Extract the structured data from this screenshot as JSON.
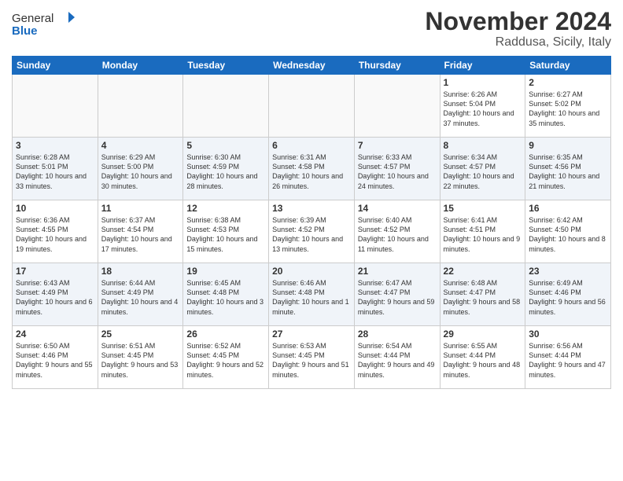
{
  "header": {
    "logo": {
      "general": "General",
      "blue": "Blue"
    },
    "month_title": "November 2024",
    "location": "Raddusa, Sicily, Italy"
  },
  "weekdays": [
    "Sunday",
    "Monday",
    "Tuesday",
    "Wednesday",
    "Thursday",
    "Friday",
    "Saturday"
  ],
  "weeks": [
    {
      "row_style": "odd-row",
      "days": [
        {
          "num": "",
          "info": "",
          "empty": true
        },
        {
          "num": "",
          "info": "",
          "empty": true
        },
        {
          "num": "",
          "info": "",
          "empty": true
        },
        {
          "num": "",
          "info": "",
          "empty": true
        },
        {
          "num": "",
          "info": "",
          "empty": true
        },
        {
          "num": "1",
          "info": "Sunrise: 6:26 AM\nSunset: 5:04 PM\nDaylight: 10 hours and 37 minutes."
        },
        {
          "num": "2",
          "info": "Sunrise: 6:27 AM\nSunset: 5:02 PM\nDaylight: 10 hours and 35 minutes."
        }
      ]
    },
    {
      "row_style": "even-row",
      "days": [
        {
          "num": "3",
          "info": "Sunrise: 6:28 AM\nSunset: 5:01 PM\nDaylight: 10 hours and 33 minutes."
        },
        {
          "num": "4",
          "info": "Sunrise: 6:29 AM\nSunset: 5:00 PM\nDaylight: 10 hours and 30 minutes."
        },
        {
          "num": "5",
          "info": "Sunrise: 6:30 AM\nSunset: 4:59 PM\nDaylight: 10 hours and 28 minutes."
        },
        {
          "num": "6",
          "info": "Sunrise: 6:31 AM\nSunset: 4:58 PM\nDaylight: 10 hours and 26 minutes."
        },
        {
          "num": "7",
          "info": "Sunrise: 6:33 AM\nSunset: 4:57 PM\nDaylight: 10 hours and 24 minutes."
        },
        {
          "num": "8",
          "info": "Sunrise: 6:34 AM\nSunset: 4:57 PM\nDaylight: 10 hours and 22 minutes."
        },
        {
          "num": "9",
          "info": "Sunrise: 6:35 AM\nSunset: 4:56 PM\nDaylight: 10 hours and 21 minutes."
        }
      ]
    },
    {
      "row_style": "odd-row",
      "days": [
        {
          "num": "10",
          "info": "Sunrise: 6:36 AM\nSunset: 4:55 PM\nDaylight: 10 hours and 19 minutes."
        },
        {
          "num": "11",
          "info": "Sunrise: 6:37 AM\nSunset: 4:54 PM\nDaylight: 10 hours and 17 minutes."
        },
        {
          "num": "12",
          "info": "Sunrise: 6:38 AM\nSunset: 4:53 PM\nDaylight: 10 hours and 15 minutes."
        },
        {
          "num": "13",
          "info": "Sunrise: 6:39 AM\nSunset: 4:52 PM\nDaylight: 10 hours and 13 minutes."
        },
        {
          "num": "14",
          "info": "Sunrise: 6:40 AM\nSunset: 4:52 PM\nDaylight: 10 hours and 11 minutes."
        },
        {
          "num": "15",
          "info": "Sunrise: 6:41 AM\nSunset: 4:51 PM\nDaylight: 10 hours and 9 minutes."
        },
        {
          "num": "16",
          "info": "Sunrise: 6:42 AM\nSunset: 4:50 PM\nDaylight: 10 hours and 8 minutes."
        }
      ]
    },
    {
      "row_style": "even-row",
      "days": [
        {
          "num": "17",
          "info": "Sunrise: 6:43 AM\nSunset: 4:49 PM\nDaylight: 10 hours and 6 minutes."
        },
        {
          "num": "18",
          "info": "Sunrise: 6:44 AM\nSunset: 4:49 PM\nDaylight: 10 hours and 4 minutes."
        },
        {
          "num": "19",
          "info": "Sunrise: 6:45 AM\nSunset: 4:48 PM\nDaylight: 10 hours and 3 minutes."
        },
        {
          "num": "20",
          "info": "Sunrise: 6:46 AM\nSunset: 4:48 PM\nDaylight: 10 hours and 1 minute."
        },
        {
          "num": "21",
          "info": "Sunrise: 6:47 AM\nSunset: 4:47 PM\nDaylight: 9 hours and 59 minutes."
        },
        {
          "num": "22",
          "info": "Sunrise: 6:48 AM\nSunset: 4:47 PM\nDaylight: 9 hours and 58 minutes."
        },
        {
          "num": "23",
          "info": "Sunrise: 6:49 AM\nSunset: 4:46 PM\nDaylight: 9 hours and 56 minutes."
        }
      ]
    },
    {
      "row_style": "odd-row",
      "days": [
        {
          "num": "24",
          "info": "Sunrise: 6:50 AM\nSunset: 4:46 PM\nDaylight: 9 hours and 55 minutes."
        },
        {
          "num": "25",
          "info": "Sunrise: 6:51 AM\nSunset: 4:45 PM\nDaylight: 9 hours and 53 minutes."
        },
        {
          "num": "26",
          "info": "Sunrise: 6:52 AM\nSunset: 4:45 PM\nDaylight: 9 hours and 52 minutes."
        },
        {
          "num": "27",
          "info": "Sunrise: 6:53 AM\nSunset: 4:45 PM\nDaylight: 9 hours and 51 minutes."
        },
        {
          "num": "28",
          "info": "Sunrise: 6:54 AM\nSunset: 4:44 PM\nDaylight: 9 hours and 49 minutes."
        },
        {
          "num": "29",
          "info": "Sunrise: 6:55 AM\nSunset: 4:44 PM\nDaylight: 9 hours and 48 minutes."
        },
        {
          "num": "30",
          "info": "Sunrise: 6:56 AM\nSunset: 4:44 PM\nDaylight: 9 hours and 47 minutes."
        }
      ]
    }
  ]
}
